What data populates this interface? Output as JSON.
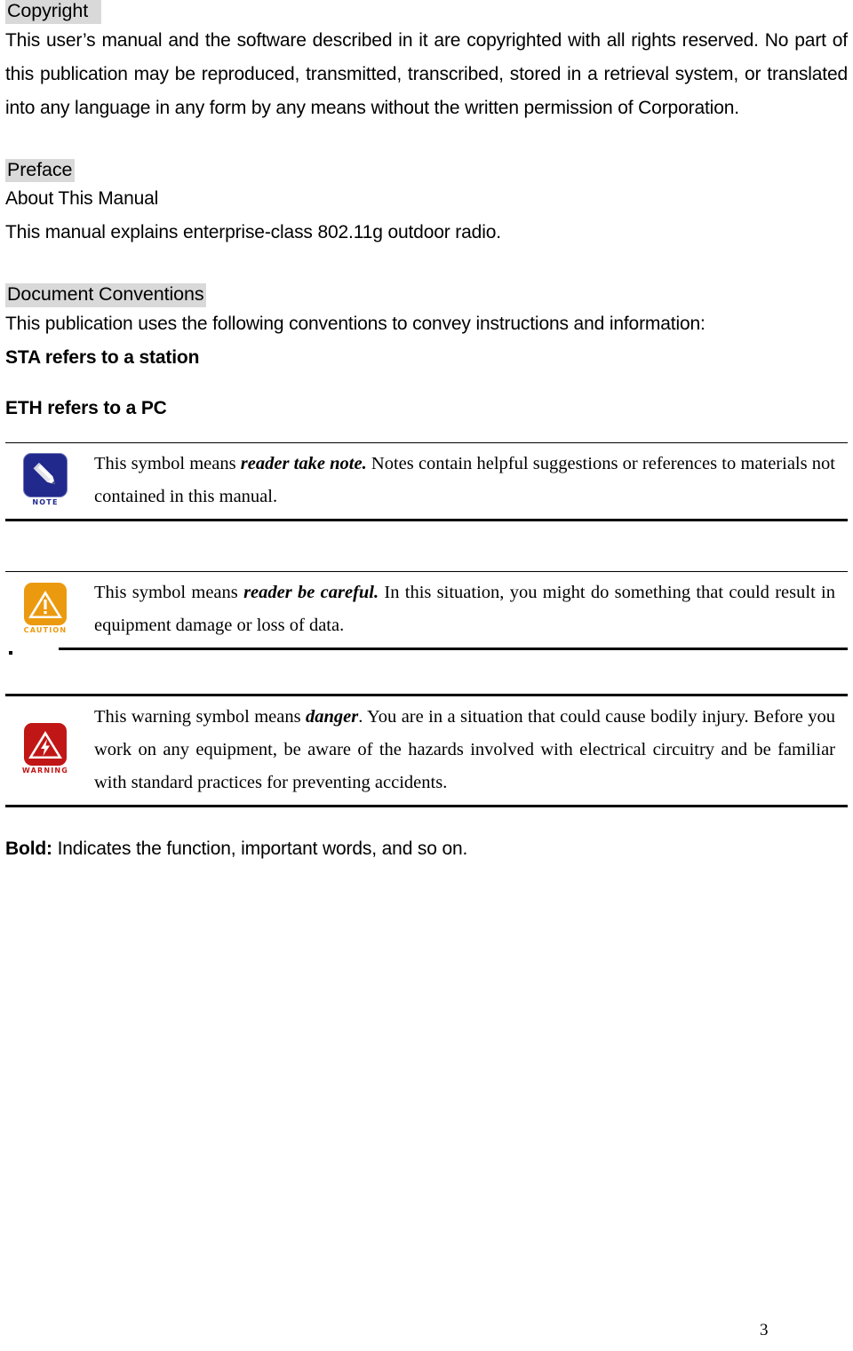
{
  "document": {
    "page_number": "3"
  },
  "sections": {
    "copyright": {
      "heading": "Copyright  ",
      "paragraph": "This user’s manual and the software described in it are copyrighted with all rights reserved. No part of this publication may be reproduced, transmitted, transcribed, stored in a retrieval system, or translated into any language in any form by any means without the written permission of Corporation."
    },
    "preface": {
      "heading": "Preface",
      "line1": "About This Manual",
      "line2": "This manual explains enterprise-class 802.11g outdoor radio."
    },
    "conventions": {
      "heading": "Document Conventions",
      "intro": "This publication uses the following conventions to convey instructions and information:",
      "sta": "STA refers to a station",
      "eth": "ETH refers to a PC",
      "bold_label": "Bold:",
      "bold_text": " Indicates the function, important words, and so on."
    }
  },
  "notices": [
    {
      "icon": "pencil-note-icon",
      "badge_label": "NOTE",
      "badge_color": "#21298c",
      "text_before": "This symbol means ",
      "emphasis": "reader take note.",
      "text_after": " Notes contain helpful suggestions or references to materials not contained in this manual."
    },
    {
      "icon": "caution-triangle-icon",
      "badge_label": "CAUTION",
      "badge_color": "#eb9a10",
      "text_before": "This symbol means ",
      "emphasis": "reader be careful.",
      "text_after": " In this situation, you might do something that could result in equipment damage or loss of data."
    },
    {
      "icon": "warning-lightning-icon",
      "badge_label": "WARNING",
      "badge_color": "#c01716",
      "text_before": "This warning symbol means ",
      "emphasis": "danger",
      "text_after": ". You are in a situation that could cause bodily injury. Before you work on any equipment, be aware of the hazards involved with electrical circuitry and be familiar with standard practices for preventing accidents."
    }
  ]
}
